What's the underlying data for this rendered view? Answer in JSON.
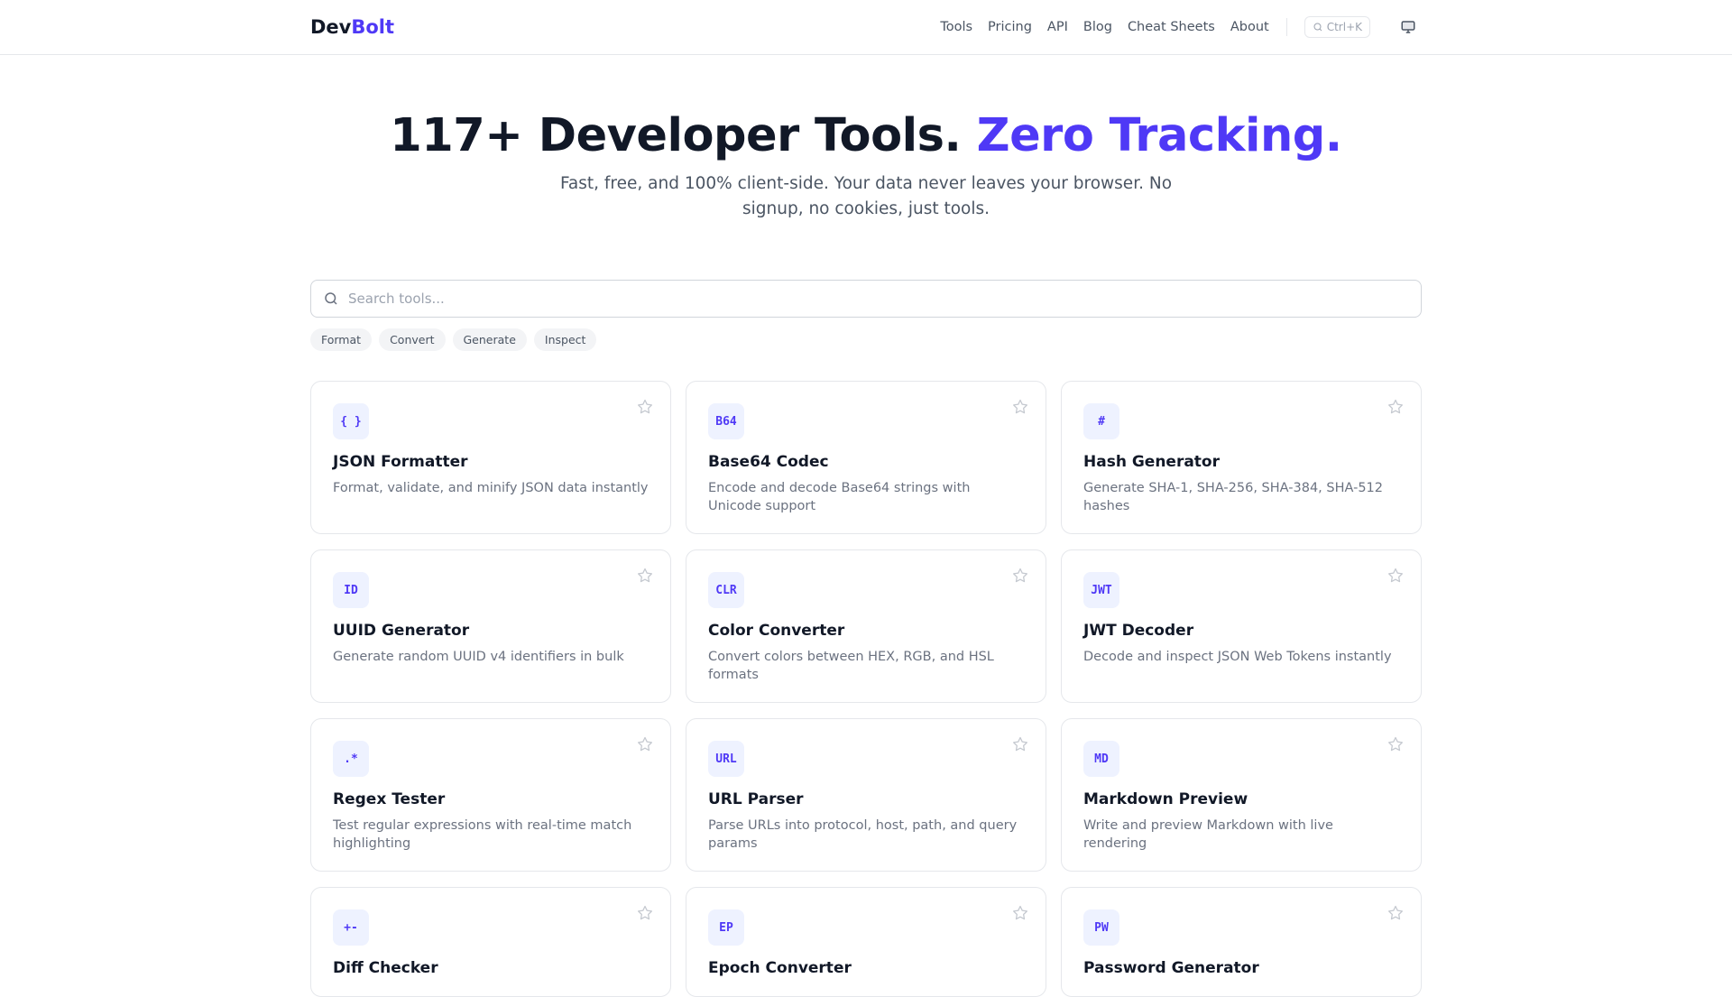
{
  "header": {
    "logo_a": "Dev",
    "logo_b": "Bolt",
    "nav": [
      "Tools",
      "Pricing",
      "API",
      "Blog",
      "Cheat Sheets",
      "About"
    ],
    "shortcut": "Ctrl+K"
  },
  "hero": {
    "title_a": "117+ Developer Tools.",
    "title_b": "Zero Tracking.",
    "subtitle": "Fast, free, and 100% client-side. Your data never leaves your browser. No signup, no cookies, just tools."
  },
  "search": {
    "placeholder": "Search tools...",
    "value": ""
  },
  "filters": [
    "Format",
    "Convert",
    "Generate",
    "Inspect"
  ],
  "tools": [
    {
      "icon": "{ }",
      "title": "JSON Formatter",
      "desc": "Format, validate, and minify JSON data instantly"
    },
    {
      "icon": "B64",
      "title": "Base64 Codec",
      "desc": "Encode and decode Base64 strings with Unicode support"
    },
    {
      "icon": "#",
      "title": "Hash Generator",
      "desc": "Generate SHA-1, SHA-256, SHA-384, SHA-512 hashes"
    },
    {
      "icon": "ID",
      "title": "UUID Generator",
      "desc": "Generate random UUID v4 identifiers in bulk"
    },
    {
      "icon": "CLR",
      "title": "Color Converter",
      "desc": "Convert colors between HEX, RGB, and HSL formats"
    },
    {
      "icon": "JWT",
      "title": "JWT Decoder",
      "desc": "Decode and inspect JSON Web Tokens instantly"
    },
    {
      "icon": ".*",
      "title": "Regex Tester",
      "desc": "Test regular expressions with real-time match highlighting"
    },
    {
      "icon": "URL",
      "title": "URL Parser",
      "desc": "Parse URLs into protocol, host, path, and query params"
    },
    {
      "icon": "MD",
      "title": "Markdown Preview",
      "desc": "Write and preview Markdown with live rendering"
    },
    {
      "icon": "+-",
      "title": "Diff Checker",
      "desc": ""
    },
    {
      "icon": "EP",
      "title": "Epoch Converter",
      "desc": ""
    },
    {
      "icon": "PW",
      "title": "Password Generator",
      "desc": ""
    }
  ]
}
